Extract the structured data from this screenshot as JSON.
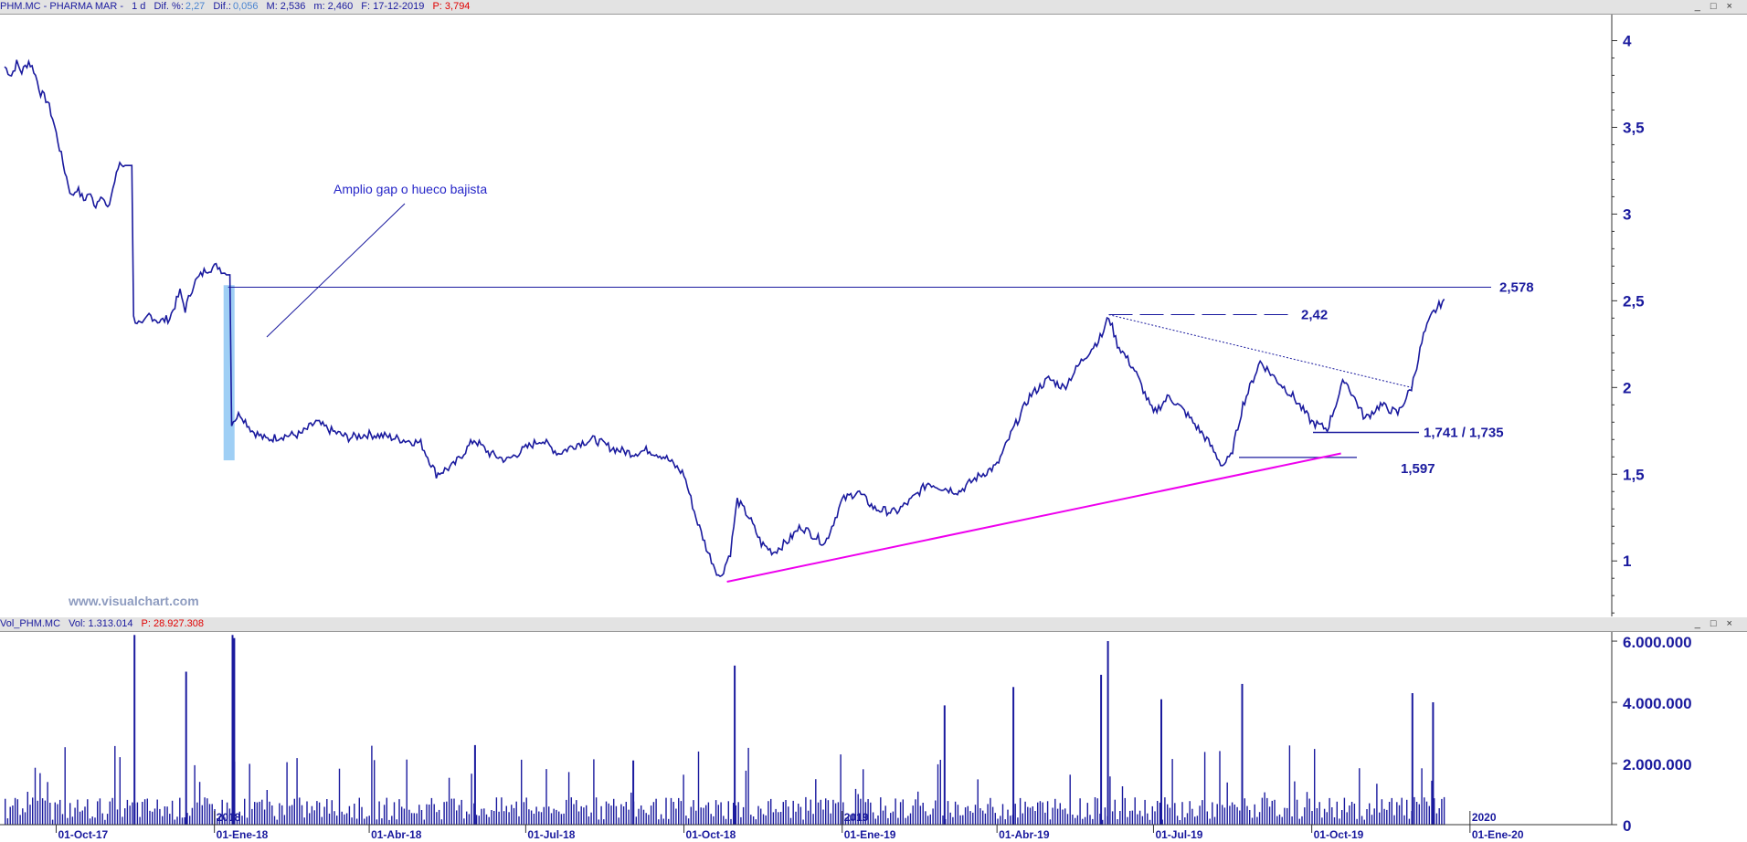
{
  "header": {
    "symbol": "PHM.MC - PHARMA MAR -",
    "interval": "1 d",
    "dif_pct_label": "Dif. %:",
    "dif_pct_value": "2,27",
    "dif_label": "Dif.:",
    "dif_value": "0,056",
    "max": "M: 2,536",
    "min": "m: 2,460",
    "date": "F: 17-12-2019",
    "price": "P: 3,794"
  },
  "volume_header": {
    "title": "Vol_PHM.MC",
    "vol": "Vol: 1.313.014",
    "price": "P: 28.927.308"
  },
  "window_buttons": "_ □ ×",
  "watermark": "www.visualchart.com",
  "colors": {
    "series": "#1a1a9e",
    "support": "#ee00ee",
    "gap": "#9fcff5",
    "background": "#ffffff"
  },
  "chart_data": [
    {
      "type": "line",
      "subtype": "ohlc-bars",
      "title": "",
      "y_ticks": [
        "4",
        "3,5",
        "3",
        "2,5",
        "2",
        "1,5",
        "1"
      ],
      "ylim": [
        0.68,
        4.15
      ],
      "x_ticks": [
        "01-Oct-17",
        "01-Ene-18",
        "01-Abr-18",
        "01-Jul-18",
        "01-Oct-18",
        "01-Ene-19",
        "01-Abr-19",
        "01-Jul-19",
        "01-Oct-19",
        "01-Ene-20"
      ],
      "year_markers": [
        "2018",
        "2019",
        "2020"
      ],
      "series": [
        {
          "values": [
            [
              "2017-09-01",
              3.85
            ],
            [
              "2017-09-05",
              3.8
            ],
            [
              "2017-09-08",
              3.87
            ],
            [
              "2017-09-11",
              3.82
            ],
            [
              "2017-09-15",
              3.88
            ],
            [
              "2017-09-18",
              3.83
            ],
            [
              "2017-09-22",
              3.7
            ],
            [
              "2017-09-26",
              3.65
            ],
            [
              "2017-09-29",
              3.55
            ],
            [
              "2017-10-03",
              3.38
            ],
            [
              "2017-10-06",
              3.25
            ],
            [
              "2017-10-10",
              3.1
            ],
            [
              "2017-10-13",
              3.15
            ],
            [
              "2017-10-17",
              3.08
            ],
            [
              "2017-10-20",
              3.12
            ],
            [
              "2017-10-24",
              3.05
            ],
            [
              "2017-10-27",
              3.12
            ],
            [
              "2017-10-31",
              3.02
            ],
            [
              "2017-11-03",
              3.15
            ],
            [
              "2017-11-07",
              3.3
            ],
            [
              "2017-11-10",
              3.28
            ],
            [
              "2017-11-15",
              2.4
            ],
            [
              "2017-11-20",
              2.35
            ],
            [
              "2017-11-24",
              2.42
            ],
            [
              "2017-11-30",
              2.38
            ],
            [
              "2017-12-06",
              2.4
            ],
            [
              "2017-12-12",
              2.55
            ],
            [
              "2017-12-15",
              2.45
            ],
            [
              "2017-12-20",
              2.6
            ],
            [
              "2017-12-27",
              2.68
            ],
            [
              "2018-01-03",
              2.7
            ],
            [
              "2018-01-08",
              2.65
            ],
            [
              "2018-01-11",
              1.8
            ],
            [
              "2018-01-16",
              1.85
            ],
            [
              "2018-01-23",
              1.75
            ],
            [
              "2018-01-31",
              1.7
            ],
            [
              "2018-02-09",
              1.72
            ],
            [
              "2018-02-20",
              1.73
            ],
            [
              "2018-03-01",
              1.8
            ],
            [
              "2018-03-10",
              1.75
            ],
            [
              "2018-03-20",
              1.71
            ],
            [
              "2018-03-31",
              1.73
            ],
            [
              "2018-04-10",
              1.72
            ],
            [
              "2018-04-20",
              1.7
            ],
            [
              "2018-05-01",
              1.68
            ],
            [
              "2018-05-10",
              1.5
            ],
            [
              "2018-05-20",
              1.55
            ],
            [
              "2018-06-01",
              1.7
            ],
            [
              "2018-06-10",
              1.62
            ],
            [
              "2018-06-20",
              1.58
            ],
            [
              "2018-07-01",
              1.65
            ],
            [
              "2018-07-10",
              1.7
            ],
            [
              "2018-07-20",
              1.62
            ],
            [
              "2018-08-01",
              1.68
            ],
            [
              "2018-08-10",
              1.7
            ],
            [
              "2018-08-20",
              1.65
            ],
            [
              "2018-09-01",
              1.62
            ],
            [
              "2018-09-10",
              1.64
            ],
            [
              "2018-09-20",
              1.6
            ],
            [
              "2018-10-01",
              1.5
            ],
            [
              "2018-10-08",
              1.25
            ],
            [
              "2018-10-15",
              1.05
            ],
            [
              "2018-10-22",
              0.9
            ],
            [
              "2018-10-28",
              1.05
            ],
            [
              "2018-11-01",
              1.35
            ],
            [
              "2018-11-08",
              1.25
            ],
            [
              "2018-11-15",
              1.1
            ],
            [
              "2018-11-22",
              1.05
            ],
            [
              "2018-12-01",
              1.12
            ],
            [
              "2018-12-08",
              1.2
            ],
            [
              "2018-12-15",
              1.15
            ],
            [
              "2018-12-22",
              1.1
            ],
            [
              "2019-01-01",
              1.35
            ],
            [
              "2019-01-10",
              1.4
            ],
            [
              "2019-01-20",
              1.3
            ],
            [
              "2019-02-01",
              1.28
            ],
            [
              "2019-02-10",
              1.35
            ],
            [
              "2019-02-20",
              1.45
            ],
            [
              "2019-03-01",
              1.42
            ],
            [
              "2019-03-10",
              1.4
            ],
            [
              "2019-03-20",
              1.48
            ],
            [
              "2019-04-01",
              1.55
            ],
            [
              "2019-04-10",
              1.75
            ],
            [
              "2019-04-20",
              1.95
            ],
            [
              "2019-05-01",
              2.05
            ],
            [
              "2019-05-10",
              2.0
            ],
            [
              "2019-05-20",
              2.15
            ],
            [
              "2019-06-01",
              2.3
            ],
            [
              "2019-06-05",
              2.41
            ],
            [
              "2019-06-10",
              2.25
            ],
            [
              "2019-06-20",
              2.1
            ],
            [
              "2019-07-01",
              1.85
            ],
            [
              "2019-07-10",
              1.95
            ],
            [
              "2019-07-20",
              1.85
            ],
            [
              "2019-08-01",
              1.7
            ],
            [
              "2019-08-10",
              1.55
            ],
            [
              "2019-08-15",
              1.6
            ],
            [
              "2019-08-22",
              1.9
            ],
            [
              "2019-09-01",
              2.15
            ],
            [
              "2019-09-10",
              2.05
            ],
            [
              "2019-09-20",
              1.95
            ],
            [
              "2019-10-01",
              1.8
            ],
            [
              "2019-10-10",
              1.76
            ],
            [
              "2019-10-20",
              2.05
            ],
            [
              "2019-11-01",
              1.82
            ],
            [
              "2019-11-10",
              1.9
            ],
            [
              "2019-11-20",
              1.85
            ],
            [
              "2019-11-28",
              2.0
            ],
            [
              "2019-12-05",
              2.3
            ],
            [
              "2019-12-10",
              2.42
            ],
            [
              "2019-12-17",
              2.51
            ]
          ]
        }
      ],
      "annotations": {
        "gap_label": "Amplio gap o hueco bajista",
        "resistance_label": "2,578",
        "resistance_value": 2.578,
        "high_label": "2,42",
        "high_value": 2.42,
        "double_low_label": "1,741 / 1,735",
        "double_low_value": 1.741,
        "support_label": "1,597",
        "support_value": 1.597,
        "gap_top": 2.59,
        "gap_bottom": 1.58,
        "rising_support": [
          [
            "2018-10-26",
            0.88
          ],
          [
            "2019-10-18",
            1.62
          ]
        ],
        "falling_trend": [
          [
            "2019-06-05",
            2.42
          ],
          [
            "2019-11-28",
            2.0
          ]
        ]
      }
    },
    {
      "type": "bar",
      "title": "",
      "y_ticks": [
        "6.000.000",
        "4.000.000",
        "2.000.000",
        "0"
      ],
      "ylim": [
        0,
        6300000
      ],
      "spikes": [
        [
          "2017-11-15",
          6200000
        ],
        [
          "2017-12-15",
          5000000
        ],
        [
          "2018-01-11",
          6200000
        ],
        [
          "2018-01-12",
          6100000
        ],
        [
          "2018-10-30",
          5200000
        ],
        [
          "2019-04-10",
          4500000
        ],
        [
          "2019-06-04",
          6000000
        ],
        [
          "2019-05-31",
          4900000
        ],
        [
          "2019-08-21",
          4600000
        ],
        [
          "2019-11-28",
          4300000
        ],
        [
          "2019-12-10",
          4000000
        ],
        [
          "2019-03-01",
          3900000
        ],
        [
          "2019-07-05",
          4100000
        ],
        [
          "2018-06-01",
          2600000
        ],
        [
          "2018-09-01",
          2100000
        ]
      ]
    }
  ]
}
